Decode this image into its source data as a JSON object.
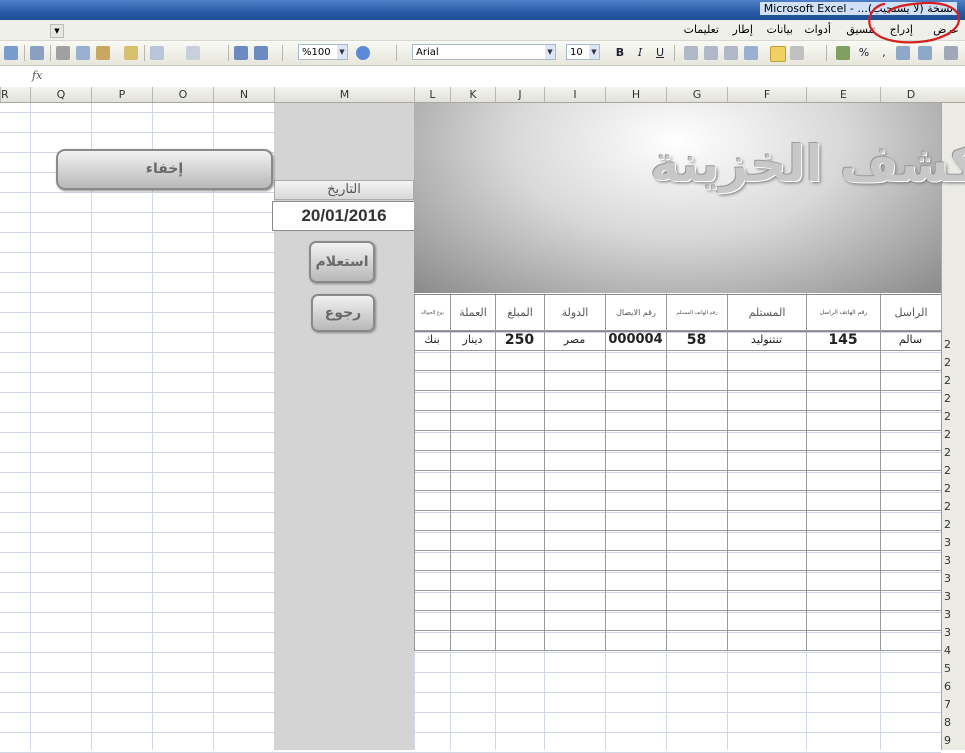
{
  "window": {
    "title": "Microsoft Excel - ...نسخة (لا يستجيب)"
  },
  "menu": [
    "عرض",
    "إدراج",
    "تنسيق",
    "أدوات",
    "بيانات",
    "إطار",
    "تعليمات"
  ],
  "toolbar": {
    "zoom": "%100",
    "font": "Arial",
    "font_size": "10"
  },
  "formula_bar": {
    "fx": "fx"
  },
  "columns": [
    "R",
    "Q",
    "P",
    "O",
    "N",
    "M",
    "L",
    "K",
    "J",
    "I",
    "H",
    "G",
    "F",
    "E",
    "D"
  ],
  "rows": [
    "2",
    "2",
    "2",
    "2",
    "2",
    "2",
    "2",
    "2",
    "2",
    "2",
    "2",
    "3",
    "3",
    "3",
    "3",
    "3",
    "3",
    "4",
    "5",
    "6",
    "7",
    "8",
    "9"
  ],
  "sheet": {
    "banner_title": "كشف الخزينة",
    "date_label": "التاريخ",
    "date_value": "20/01/2016",
    "query_button": "استعلام",
    "back_button": "رجوع",
    "hide_button": "إخفاء"
  },
  "table": {
    "headers": [
      "نوع الحوالة",
      "العملة",
      "المبلغ",
      "الدولة",
      "رقم الايصال",
      "رقم الهاتف المستلم",
      "المستلم",
      "رقم الهاتف الراسل",
      "الراسل"
    ],
    "rows": [
      [
        "بنك",
        "دينار",
        "250",
        "مصر",
        "000004",
        "58",
        "تنتنوليد",
        "145",
        "سالم"
      ]
    ]
  },
  "colors": {
    "annotation": "#d42020",
    "panel_gray": "#d4d4d4"
  }
}
